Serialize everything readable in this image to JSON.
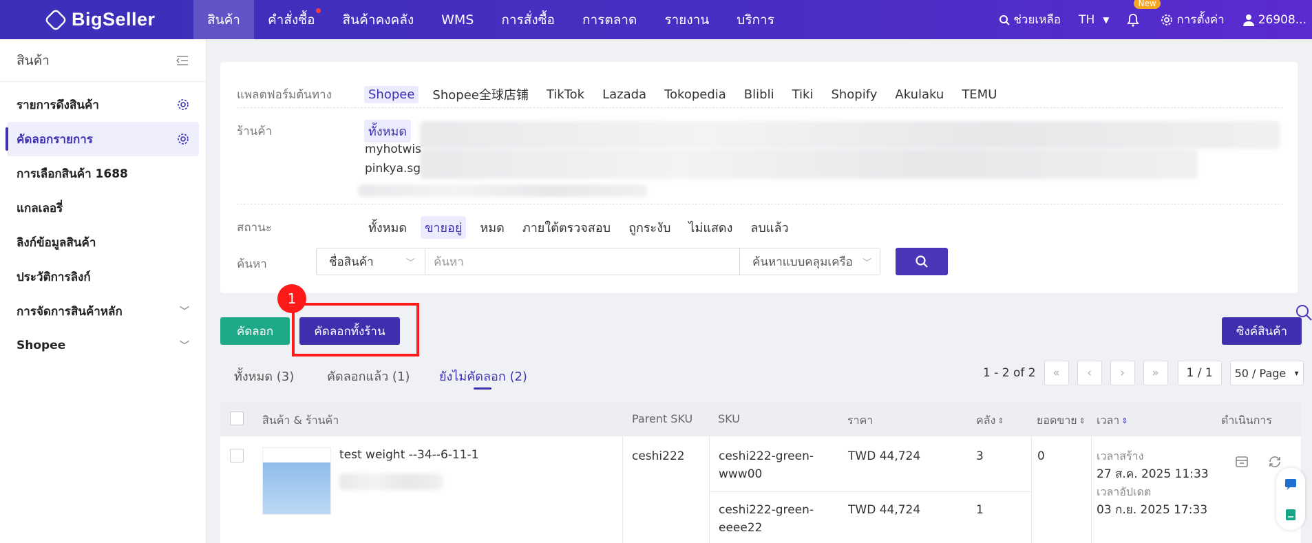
{
  "brand": {
    "name": "BigSeller"
  },
  "topnav": {
    "items": [
      "สินค้า",
      "คำสั่งซื้อ",
      "สินค้าคงคลัง",
      "WMS",
      "การสั่งซื้อ",
      "การตลาด",
      "รายงาน",
      "บริการ"
    ],
    "help": "ช่วยเหลือ",
    "lang": "TH",
    "new_badge": "New",
    "settings": "การตั้งค่า",
    "user": "26908..."
  },
  "sidebar": {
    "title": "สินค้า",
    "items": [
      "รายการดึงสินค้า",
      "คัดลอกรายการ",
      "การเลือกสินค้า 1688",
      "แกลเลอรี่",
      "ลิงก์ข้อมูลสินค้า",
      "ประวัติการลิงก์",
      "การจัดการสินค้าหลัก",
      "Shopee"
    ]
  },
  "filters": {
    "platform_label": "แพลตฟอร์มต้นทาง",
    "platforms": [
      "Shopee",
      "Shopee全球店铺",
      "TikTok",
      "Lazada",
      "Tokopedia",
      "Blibli",
      "Tiki",
      "Shopify",
      "Akulaku",
      "TEMU"
    ],
    "shop_label": "ร้านค้า",
    "shop_all": "ทั้งหมด",
    "shops": [
      "myhotwis",
      "pinkya.sg"
    ],
    "status_label": "สถานะ",
    "statuses": [
      "ทั้งหมด",
      "ขายอยู่",
      "หมด",
      "ภายใต้ตรวจสอบ",
      "ถูกระงับ",
      "ไม่แสดง",
      "ลบแล้ว"
    ],
    "search_label": "ค้นหา",
    "search_field": "ชื่อสินค้า",
    "search_placeholder": "ค้นหา",
    "search_mode": "ค้นหาแบบคลุมเครือ"
  },
  "actions": {
    "copy": "คัดลอก",
    "copy_all_store": "คัดลอกทั้งร้าน",
    "sync": "ซิงค์สินค้า",
    "annotation_number": "1"
  },
  "tabs": [
    "ทั้งหมด (3)",
    "คัดลอกแล้ว (1)",
    "ยังไม่คัดลอก (2)"
  ],
  "pagination": {
    "range": "1 - 2 of 2",
    "page": "1 / 1",
    "page_size": "50 / Page"
  },
  "table": {
    "headers": [
      "สินค้า & ร้านค้า",
      "Parent SKU",
      "SKU",
      "ราคา",
      "คลัง",
      "ยอดขาย",
      "เวลา",
      "ดำเนินการ"
    ],
    "row": {
      "title": "test weight --34--6-11-1",
      "parent_sku": "ceshi222",
      "variants": [
        {
          "sku": "ceshi222-green-www00",
          "price": "TWD 44,724",
          "stock": "3"
        },
        {
          "sku": "ceshi222-green-eeee22",
          "price": "TWD 44,724",
          "stock": "1"
        }
      ],
      "sales": "0",
      "created_label": "เวลาสร้าง",
      "created": "27 ส.ค. 2025 11:33",
      "updated_label": "เวลาอัปเดต",
      "updated": "03 ก.ย. 2025 17:33"
    }
  }
}
